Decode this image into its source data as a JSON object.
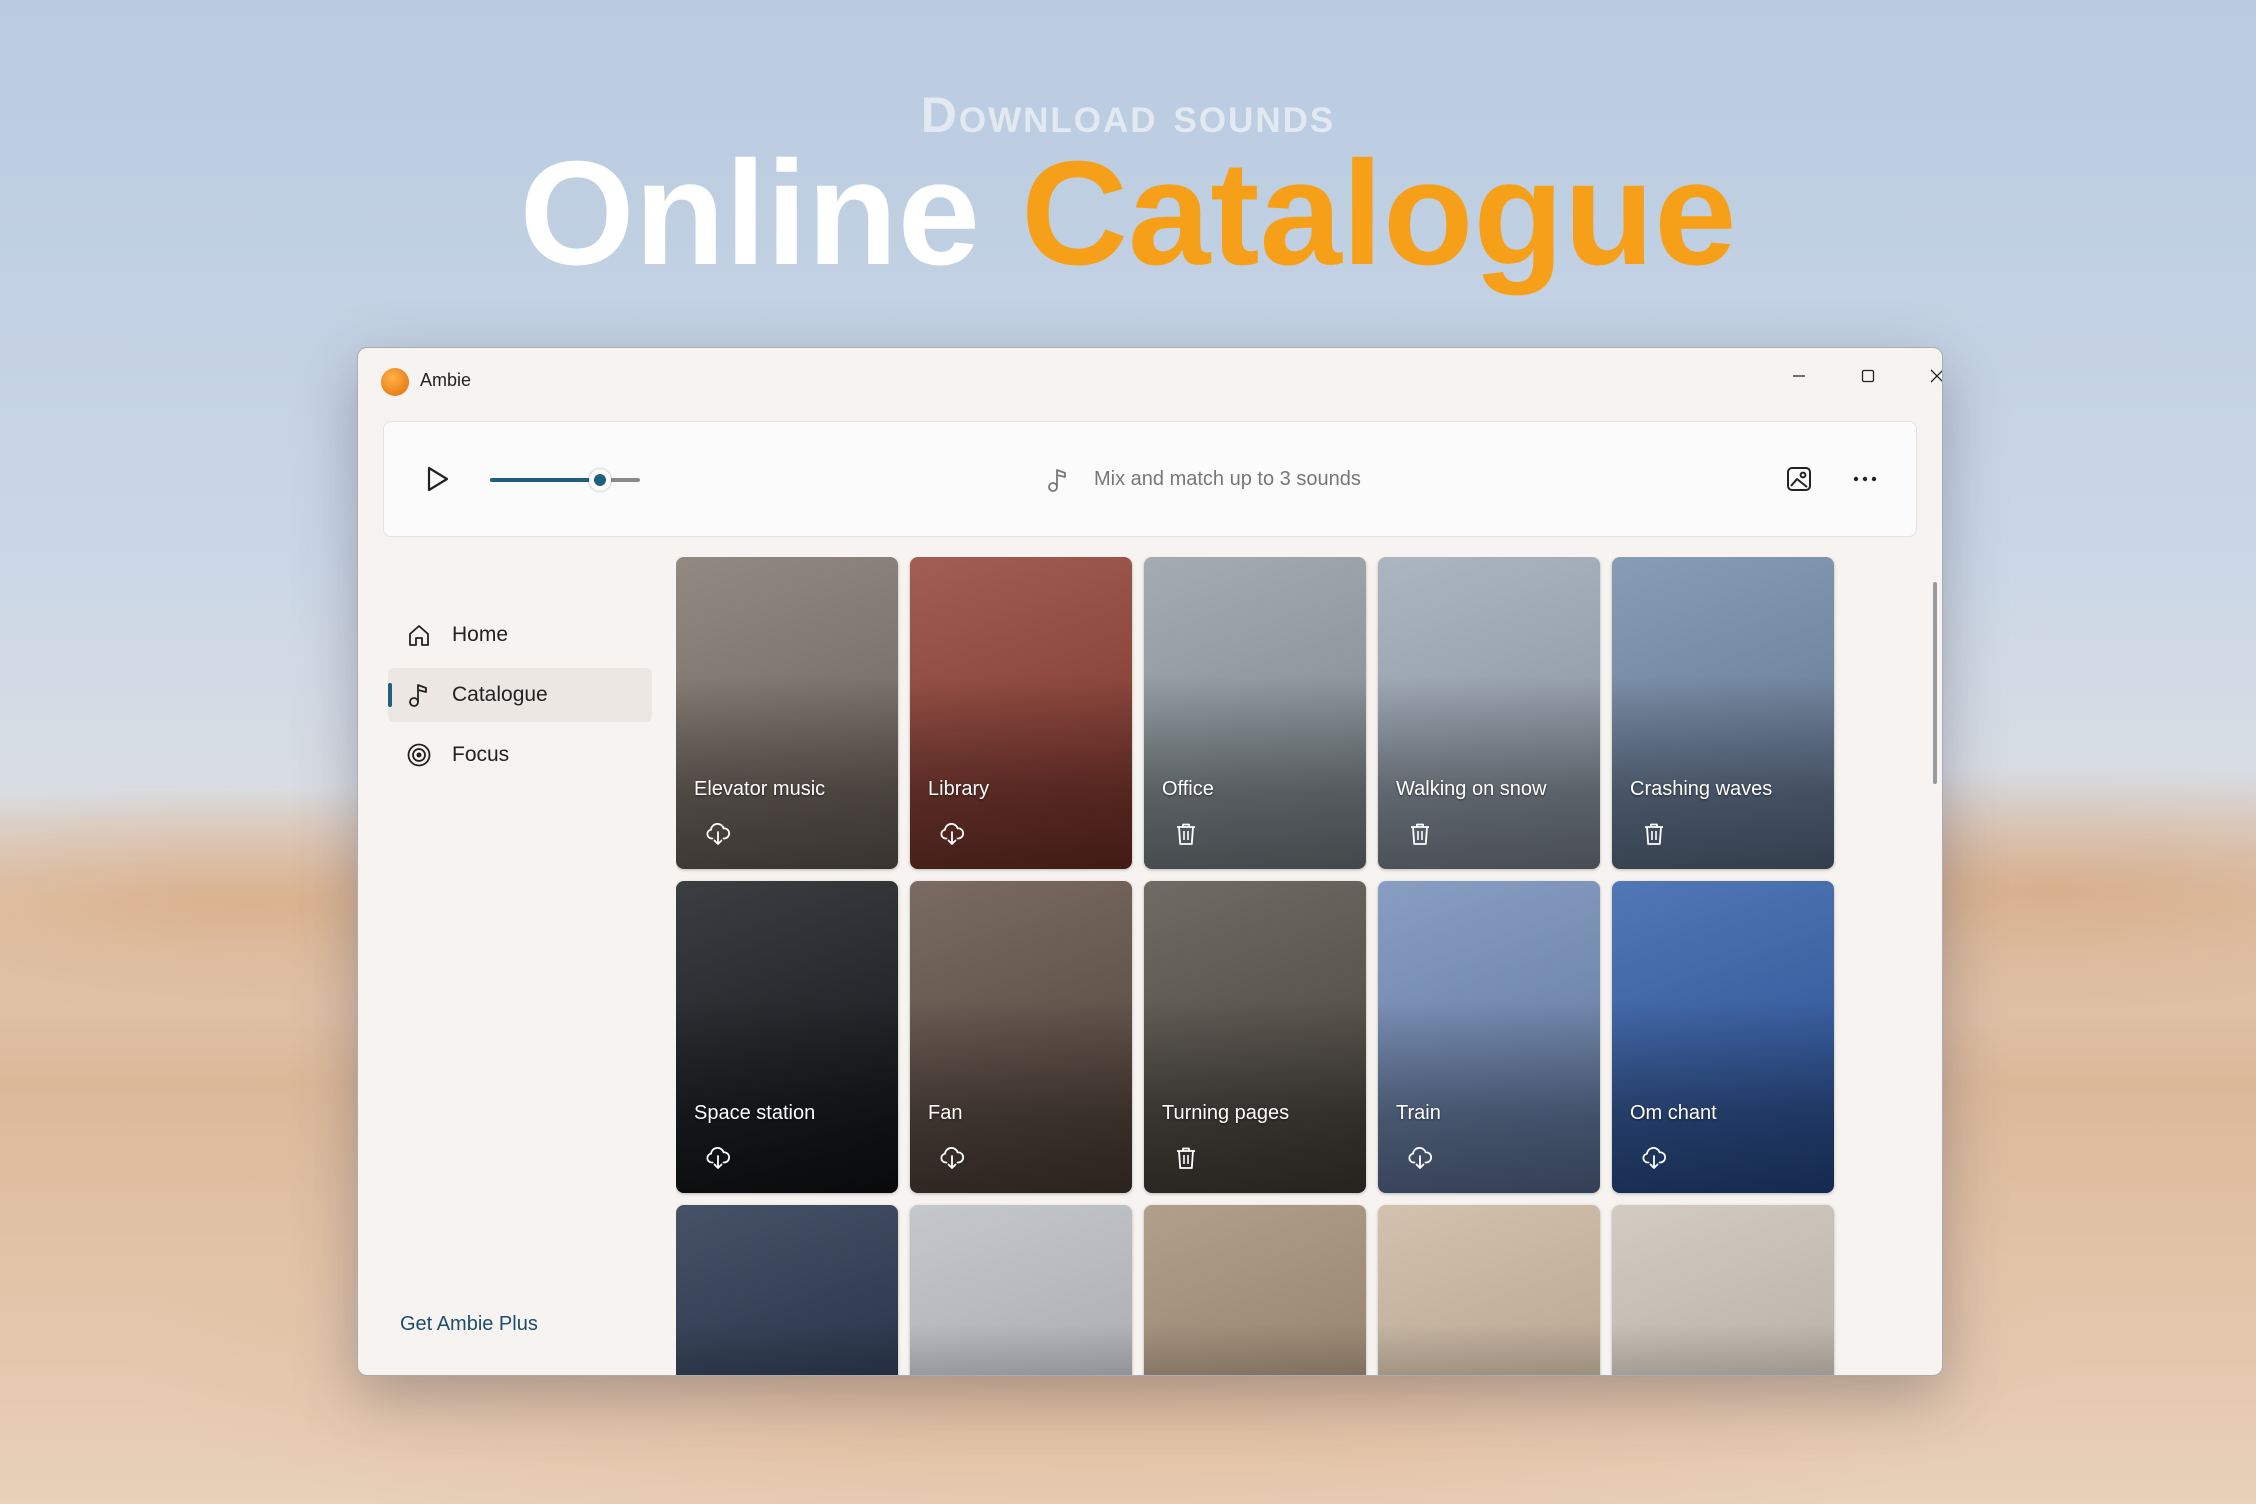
{
  "hero": {
    "subtitle": "Download sounds",
    "title_white": "Online",
    "title_orange": "Catalogue"
  },
  "window": {
    "app_name": "Ambie",
    "controls": {
      "minimize": "minimize-icon",
      "maximize": "maximize-icon",
      "close": "close-icon"
    }
  },
  "player": {
    "volume_percent": 73,
    "mix_text": "Mix and match up to 3 sounds"
  },
  "nav": {
    "items": [
      {
        "label": "Home",
        "icon": "home-icon",
        "selected": false
      },
      {
        "label": "Catalogue",
        "icon": "music-note-icon",
        "selected": true
      },
      {
        "label": "Focus",
        "icon": "target-icon",
        "selected": false
      }
    ],
    "footer_link": "Get Ambie Plus"
  },
  "catalogue": {
    "cards": [
      {
        "title": "Elevator music",
        "action": "download",
        "bg": "#7a6f66"
      },
      {
        "title": "Library",
        "action": "download",
        "bg": "#8d3a2e"
      },
      {
        "title": "Office",
        "action": "delete",
        "bg": "#8f9aa0"
      },
      {
        "title": "Walking on snow",
        "action": "delete",
        "bg": "#9aa6b4"
      },
      {
        "title": "Crashing waves",
        "action": "delete",
        "bg": "#6e86a4"
      },
      {
        "title": "Space station",
        "action": "download",
        "bg": "#101418"
      },
      {
        "title": "Fan",
        "action": "download",
        "bg": "#5c4a40"
      },
      {
        "title": "Turning pages",
        "action": "delete",
        "bg": "#504a42"
      },
      {
        "title": "Train",
        "action": "download",
        "bg": "#6d88b5"
      },
      {
        "title": "Om chant",
        "action": "download",
        "bg": "#2c59a6"
      },
      {
        "title": "",
        "action": "",
        "bg": "#1d2c45"
      },
      {
        "title": "",
        "action": "",
        "bg": "#b7bcc1"
      },
      {
        "title": "",
        "action": "",
        "bg": "#a08a72"
      },
      {
        "title": "",
        "action": "",
        "bg": "#c7b49c"
      },
      {
        "title": "",
        "action": "",
        "bg": "#c9c0b4"
      }
    ]
  },
  "colors": {
    "accent": "#1f5f80",
    "hero_orange": "#f6a01a"
  }
}
